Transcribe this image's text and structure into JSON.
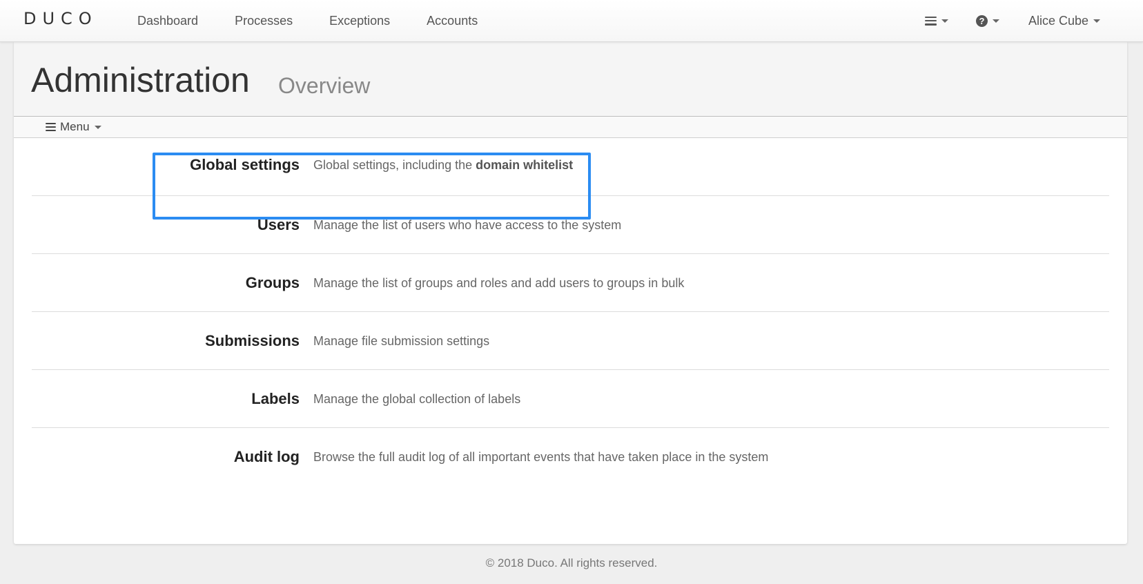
{
  "navbar": {
    "brand": "DUCO",
    "links": [
      "Dashboard",
      "Processes",
      "Exceptions",
      "Accounts"
    ],
    "menu_icon": "hamburger-icon",
    "help_icon": "question-circle-icon",
    "help_glyph": "?",
    "user_name": "Alice Cube"
  },
  "header": {
    "title": "Administration",
    "subtitle": "Overview"
  },
  "submenu": {
    "label": "Menu",
    "icon": "hamburger-icon"
  },
  "admin_items": [
    {
      "title": "Global settings",
      "description": "Global settings, including the",
      "description_bold": "domain whitelist"
    },
    {
      "title": "Users",
      "description": "Manage the list of users who have access to the system"
    },
    {
      "title": "Groups",
      "description": "Manage the list of groups and roles and add users to groups in bulk"
    },
    {
      "title": "Submissions",
      "description": "Manage file submission settings"
    },
    {
      "title": "Labels",
      "description": "Manage the global collection of labels"
    },
    {
      "title": "Audit log",
      "description": "Browse the full audit log of all important events that have taken place in the system"
    }
  ],
  "highlight": {
    "target": "Global settings",
    "color": "#2b8cf2"
  },
  "footer": {
    "text": "© 2018 Duco. All rights reserved."
  }
}
